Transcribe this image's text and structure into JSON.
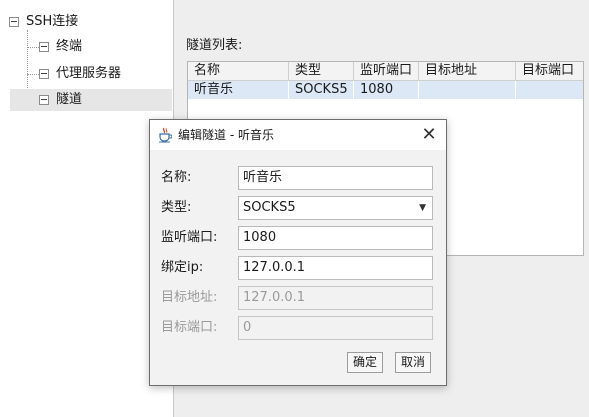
{
  "tree": {
    "root": "SSH连接",
    "children": [
      "终端",
      "代理服务器",
      "隧道"
    ]
  },
  "tunnel_list": {
    "label": "隧道列表:",
    "columns": [
      "名称",
      "类型",
      "监听端口",
      "目标地址",
      "目标端口"
    ],
    "rows": [
      [
        "听音乐",
        "SOCKS5",
        "1080",
        "",
        ""
      ]
    ]
  },
  "dialog": {
    "title": "编辑隧道 - 听音乐",
    "close_glyph": "✕",
    "fields": {
      "name": {
        "label": "名称:",
        "value": "听音乐"
      },
      "type": {
        "label": "类型:",
        "value": "SOCKS5"
      },
      "listen_port": {
        "label": "监听端口:",
        "value": "1080"
      },
      "bind_ip": {
        "label": "绑定ip:",
        "value": "127.0.0.1"
      },
      "target_addr": {
        "label": "目标地址:",
        "value": "127.0.0.1"
      },
      "target_port": {
        "label": "目标端口:",
        "value": "0"
      }
    },
    "ok_label": "确定",
    "cancel_label": "取消"
  },
  "icons": {
    "tree_expander": "collapse-box-icon",
    "dialog_app": "java-cup-icon",
    "close": "close-icon",
    "dropdown": "chevron-down-icon"
  },
  "colors": {
    "selected_row": "#dce8f5",
    "selected_tree": "#e6e6e6",
    "disabled_text": "#9a9a9a"
  }
}
